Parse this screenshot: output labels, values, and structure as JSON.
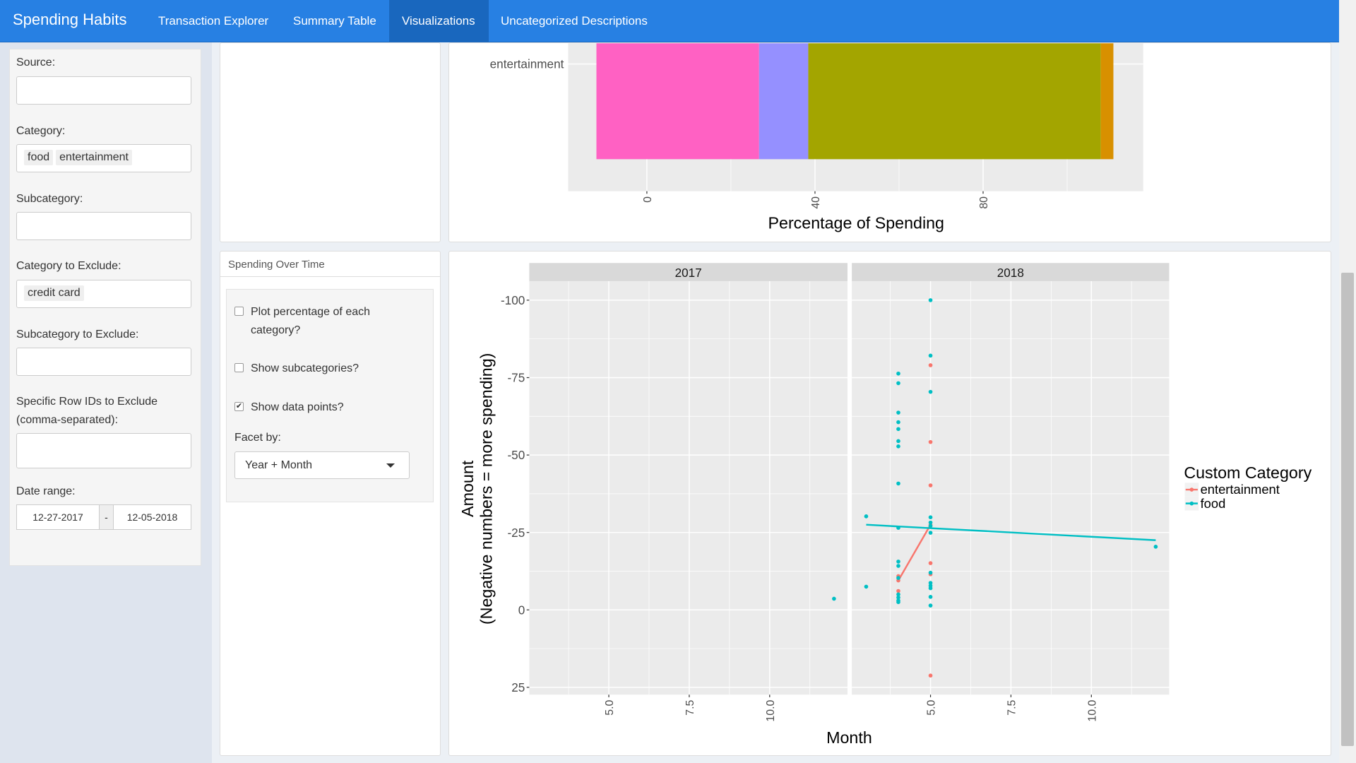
{
  "navbar": {
    "brand": "Spending Habits",
    "tabs": [
      {
        "label": "Transaction Explorer"
      },
      {
        "label": "Summary Table"
      },
      {
        "label": "Visualizations",
        "active": true
      },
      {
        "label": "Uncategorized Descriptions"
      }
    ]
  },
  "sidebar": {
    "source_label": "Source:",
    "source_value": "",
    "category_label": "Category:",
    "category_values": [
      "food",
      "entertainment"
    ],
    "subcategory_label": "Subcategory:",
    "subcategory_value": "",
    "cat_exclude_label": "Category to Exclude:",
    "cat_exclude_values": [
      "credit card"
    ],
    "subcat_exclude_label": "Subcategory to Exclude:",
    "subcat_exclude_value": "",
    "row_ids_label_1": "Specific Row IDs to Exclude",
    "row_ids_label_2": "(comma-separated):",
    "row_ids_value": "",
    "date_label": "Date range:",
    "date_start": "12-27-2017",
    "date_sep": "-",
    "date_end": "12-05-2018"
  },
  "options": {
    "title": "Spending Over Time",
    "pct_label_1": "Plot percentage of each",
    "pct_label_2": "category?",
    "pct_checked": false,
    "subcat_label": "Show subcategories?",
    "subcat_checked": false,
    "points_label": "Show data points?",
    "points_checked": true,
    "facet_label": "Facet by:",
    "facet_value": "Year + Month"
  },
  "chart_data": [
    {
      "type": "bar",
      "orientation": "horizontal",
      "stacked": true,
      "categories": [
        "entertainment"
      ],
      "segments": [
        {
          "from": -12,
          "to": 26.7,
          "color": "#FF61C3"
        },
        {
          "from": 26.7,
          "to": 38.4,
          "color": "#9590FF"
        },
        {
          "from": 38.4,
          "to": 108,
          "color": "#A3A500"
        },
        {
          "from": 108,
          "to": 111,
          "color": "#D89000"
        }
      ],
      "xlabel": "Percentage of Spending",
      "xticks": [
        "0",
        "40",
        "80"
      ],
      "xlim": [
        -18.6,
        117
      ]
    },
    {
      "type": "scatter",
      "facets": [
        "2017",
        "2018"
      ],
      "xlabel": "Month",
      "ylabel": [
        "Amount",
        "(Negative numbers = more spending)"
      ],
      "xticks": [
        "5.0",
        "7.5",
        "10.0"
      ],
      "xlim": [
        2.55,
        12.4
      ],
      "ylim": [
        -100,
        25
      ],
      "y_reversed": true,
      "yticks": [
        "-100",
        "-75",
        "-50",
        "-25",
        "0",
        "25"
      ],
      "legend": {
        "title": "Custom Category",
        "position": "right"
      },
      "series": [
        {
          "name": "entertainment",
          "color": "#F8766D",
          "points": [
            {
              "facet": "2018",
              "x": 4,
              "y": -10.9
            },
            {
              "facet": "2018",
              "x": 4,
              "y": -9.5
            },
            {
              "facet": "2018",
              "x": 4,
              "y": -6.1
            },
            {
              "facet": "2018",
              "x": 5,
              "y": -79
            },
            {
              "facet": "2018",
              "x": 5,
              "y": -54.2
            },
            {
              "facet": "2018",
              "x": 5,
              "y": -40.2
            },
            {
              "facet": "2018",
              "x": 5,
              "y": -27.4
            },
            {
              "facet": "2018",
              "x": 5,
              "y": -15.1
            },
            {
              "facet": "2018",
              "x": 5,
              "y": -11.5
            },
            {
              "facet": "2018",
              "x": 5,
              "y": 21.2
            }
          ],
          "trend": {
            "facet": "2018",
            "x": [
              4,
              5
            ],
            "y": [
              -9.5,
              -27.5
            ]
          }
        },
        {
          "name": "food",
          "color": "#00BFC4",
          "points": [
            {
              "facet": "2017",
              "x": 12,
              "y": -3.6
            },
            {
              "facet": "2018",
              "x": 3,
              "y": -30.2
            },
            {
              "facet": "2018",
              "x": 3,
              "y": -7.5
            },
            {
              "facet": "2018",
              "x": 4,
              "y": -76.3
            },
            {
              "facet": "2018",
              "x": 4,
              "y": -73.2
            },
            {
              "facet": "2018",
              "x": 4,
              "y": -63.7
            },
            {
              "facet": "2018",
              "x": 4,
              "y": -60.6
            },
            {
              "facet": "2018",
              "x": 4,
              "y": -58.4
            },
            {
              "facet": "2018",
              "x": 4,
              "y": -54.5
            },
            {
              "facet": "2018",
              "x": 4,
              "y": -52.8
            },
            {
              "facet": "2018",
              "x": 4,
              "y": -40.8
            },
            {
              "facet": "2018",
              "x": 4,
              "y": -26.5
            },
            {
              "facet": "2018",
              "x": 4,
              "y": -15.6
            },
            {
              "facet": "2018",
              "x": 4,
              "y": -14.2
            },
            {
              "facet": "2018",
              "x": 4,
              "y": -10.3
            },
            {
              "facet": "2018",
              "x": 4,
              "y": -5
            },
            {
              "facet": "2018",
              "x": 4,
              "y": -4
            },
            {
              "facet": "2018",
              "x": 4,
              "y": -3
            },
            {
              "facet": "2018",
              "x": 4,
              "y": -2.5
            },
            {
              "facet": "2018",
              "x": 5,
              "y": -100
            },
            {
              "facet": "2018",
              "x": 5,
              "y": -82.1
            },
            {
              "facet": "2018",
              "x": 5,
              "y": -70.4
            },
            {
              "facet": "2018",
              "x": 5,
              "y": -29.9
            },
            {
              "facet": "2018",
              "x": 5,
              "y": -28.2
            },
            {
              "facet": "2018",
              "x": 5,
              "y": -27.1
            },
            {
              "facet": "2018",
              "x": 5,
              "y": -24.9
            },
            {
              "facet": "2018",
              "x": 5,
              "y": -12
            },
            {
              "facet": "2018",
              "x": 5,
              "y": -8.7
            },
            {
              "facet": "2018",
              "x": 5,
              "y": -7.8
            },
            {
              "facet": "2018",
              "x": 5,
              "y": -7
            },
            {
              "facet": "2018",
              "x": 5,
              "y": -4.2
            },
            {
              "facet": "2018",
              "x": 5,
              "y": -1.4
            },
            {
              "facet": "2018",
              "x": 12,
              "y": -20.4
            }
          ],
          "trend": {
            "facet": "2018",
            "x": [
              3,
              12
            ],
            "y": [
              -27.5,
              -22.5
            ]
          }
        }
      ]
    }
  ]
}
